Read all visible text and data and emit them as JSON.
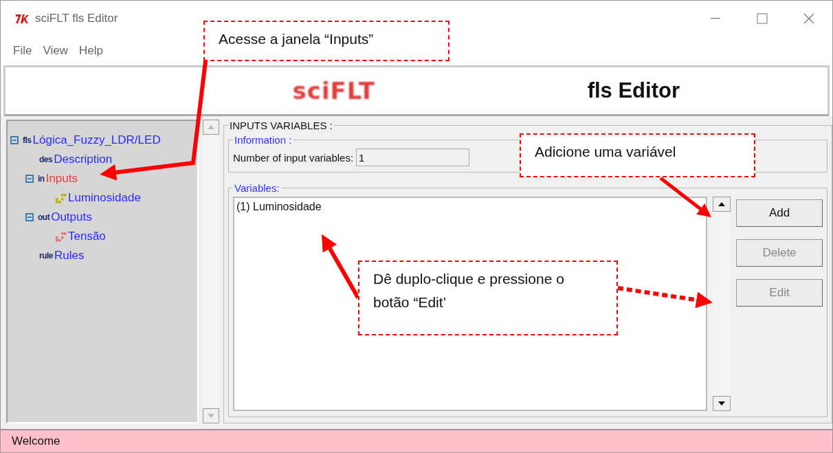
{
  "window": {
    "title": "sciFLT fls Editor"
  },
  "menu": [
    "File",
    "View",
    "Help"
  ],
  "banner": {
    "logo": "sciFLT",
    "heading": "fls Editor"
  },
  "tree": [
    {
      "badge": "fls",
      "label": "Lógica_Fuzzy_LDR/LED",
      "selected": false,
      "expanded": true,
      "children": [
        {
          "badge": "des",
          "label": "Description",
          "selected": false
        },
        {
          "badge": "in",
          "label": "Inputs",
          "selected": true,
          "expanded": true,
          "children": [
            {
              "kind": "input",
              "label": "Luminosidade",
              "selected": false
            }
          ]
        },
        {
          "badge": "out",
          "label": "Outputs",
          "selected": false,
          "expanded": true,
          "children": [
            {
              "kind": "output",
              "label": "Tensão",
              "selected": false
            }
          ]
        },
        {
          "badge": "rule",
          "label": "Rules",
          "selected": false
        }
      ]
    }
  ],
  "inputs": {
    "title": "INPUTS VARIABLES :",
    "information": {
      "title": "Information :",
      "field_label": "Number of input variables:",
      "field_value": "1"
    },
    "variables": {
      "title": "Variables:",
      "items": [
        {
          "label": "(1) Luminosidade",
          "selected": false
        }
      ]
    },
    "buttons": [
      {
        "label": "Add",
        "disabled": false
      },
      {
        "label": "Delete",
        "disabled": true
      },
      {
        "label": "Edit",
        "disabled": true
      }
    ]
  },
  "status_bar": "Welcome",
  "annotations": [
    {
      "text": "Acesse a janela “Inputs”"
    },
    {
      "text": "Adicione uma variável"
    },
    {
      "text": "Dê duplo-clique e pressione o botão “Edit’"
    }
  ]
}
